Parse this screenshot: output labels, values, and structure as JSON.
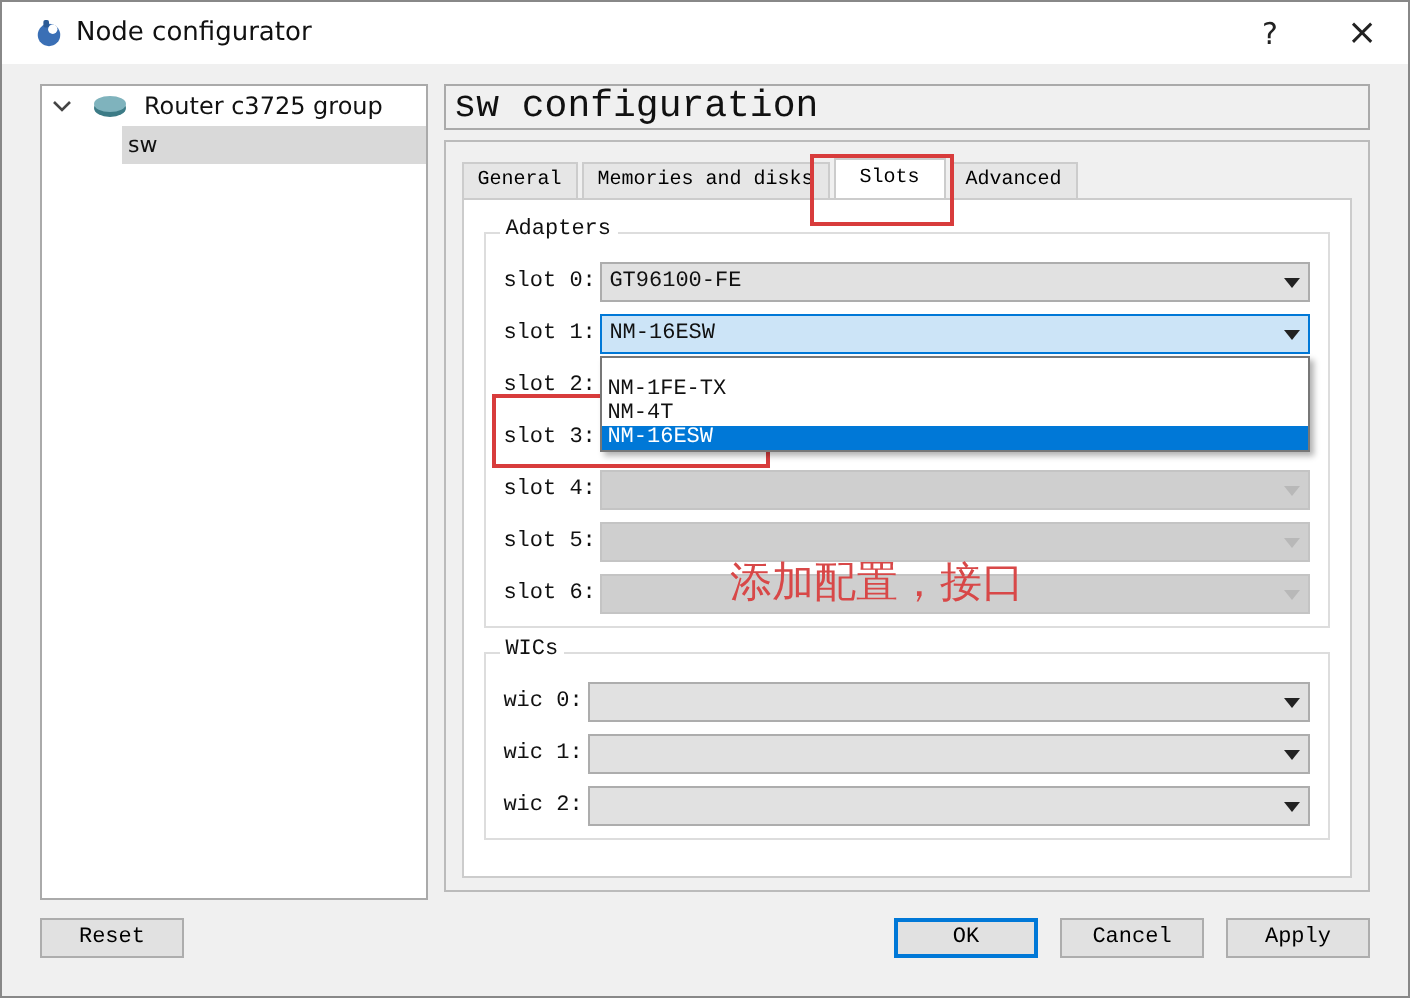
{
  "window": {
    "title": "Node configurator",
    "help": "?",
    "close": "×"
  },
  "tree": [
    {
      "label": "Router c3725 group",
      "expanded": true,
      "children": [
        {
          "label": "sw",
          "selected": true
        }
      ]
    }
  ],
  "header": "sw configuration",
  "tabs": [
    {
      "label": "General",
      "selected": false
    },
    {
      "label": "Memories and disks",
      "selected": false
    },
    {
      "label": "Slots",
      "selected": true
    },
    {
      "label": "Advanced",
      "selected": false
    }
  ],
  "adapters": {
    "title": "Adapters",
    "slots": [
      {
        "kind": "combo",
        "label": "slot 0:",
        "value": "GT96100-FE",
        "disabled": false,
        "open": false
      },
      {
        "kind": "combo",
        "label": "slot 1:",
        "value": "NM-16ESW",
        "disabled": false,
        "open": true
      },
      {
        "kind": "covered",
        "label": "slot 2:"
      },
      {
        "kind": "covered",
        "label": "slot 3:"
      },
      {
        "kind": "combo",
        "label": "slot 4:",
        "disabled": true,
        "open": false
      },
      {
        "kind": "combo",
        "label": "slot 5:",
        "disabled": true,
        "open": false
      },
      {
        "kind": "combo",
        "label": "slot 6:",
        "disabled": true,
        "open": false
      }
    ]
  },
  "dropdown": {
    "items": [
      {
        "label": "NM-1FE-TX",
        "selected": false
      },
      {
        "label": "NM-4T",
        "selected": false
      },
      {
        "label": "NM-16ESW",
        "selected": true
      }
    ]
  },
  "wics": {
    "title": "WICs",
    "slots": [
      {
        "label": "wic 0:",
        "disabled": false
      },
      {
        "label": "wic 1:",
        "disabled": false
      },
      {
        "label": "wic 2:",
        "disabled": false
      }
    ]
  },
  "buttons": [
    {
      "label": "Reset",
      "default": false
    },
    {
      "label": "OK",
      "default": true
    },
    {
      "label": "Cancel",
      "default": false
    },
    {
      "label": "Apply",
      "default": false
    }
  ],
  "annotation": {
    "text": "添加配置，接口"
  }
}
